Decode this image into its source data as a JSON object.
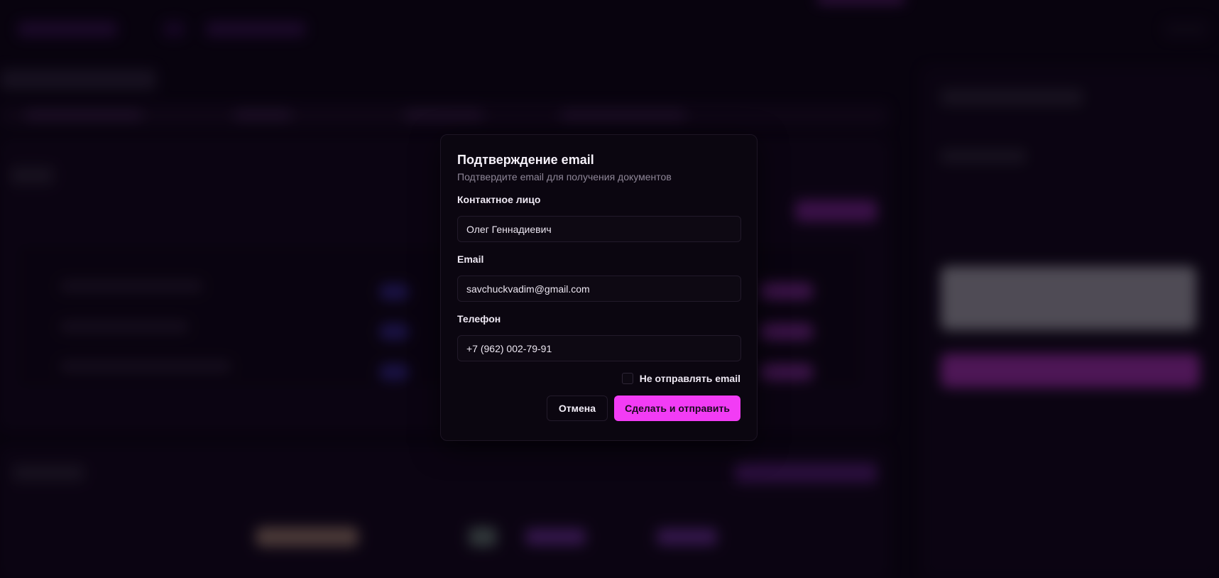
{
  "dialog": {
    "title": "Подтверждение email",
    "subtitle": "Подтвердите email для получения документов",
    "contact_label": "Контактное лицо",
    "contact_value": "Олег Геннадиевич",
    "email_label": "Email",
    "email_value": "savchuckvadim@gmail.com",
    "phone_label": "Телефон",
    "phone_value": "+7 (962) 002-79-91",
    "no_email_label": "Не отправлять email",
    "no_email_checked": false,
    "cancel_label": "Отмена",
    "submit_label": "Сделать и отправить"
  },
  "colors": {
    "accent": "#f23cf5",
    "background": "#0a0412",
    "modal_bg": "#0b0610"
  }
}
